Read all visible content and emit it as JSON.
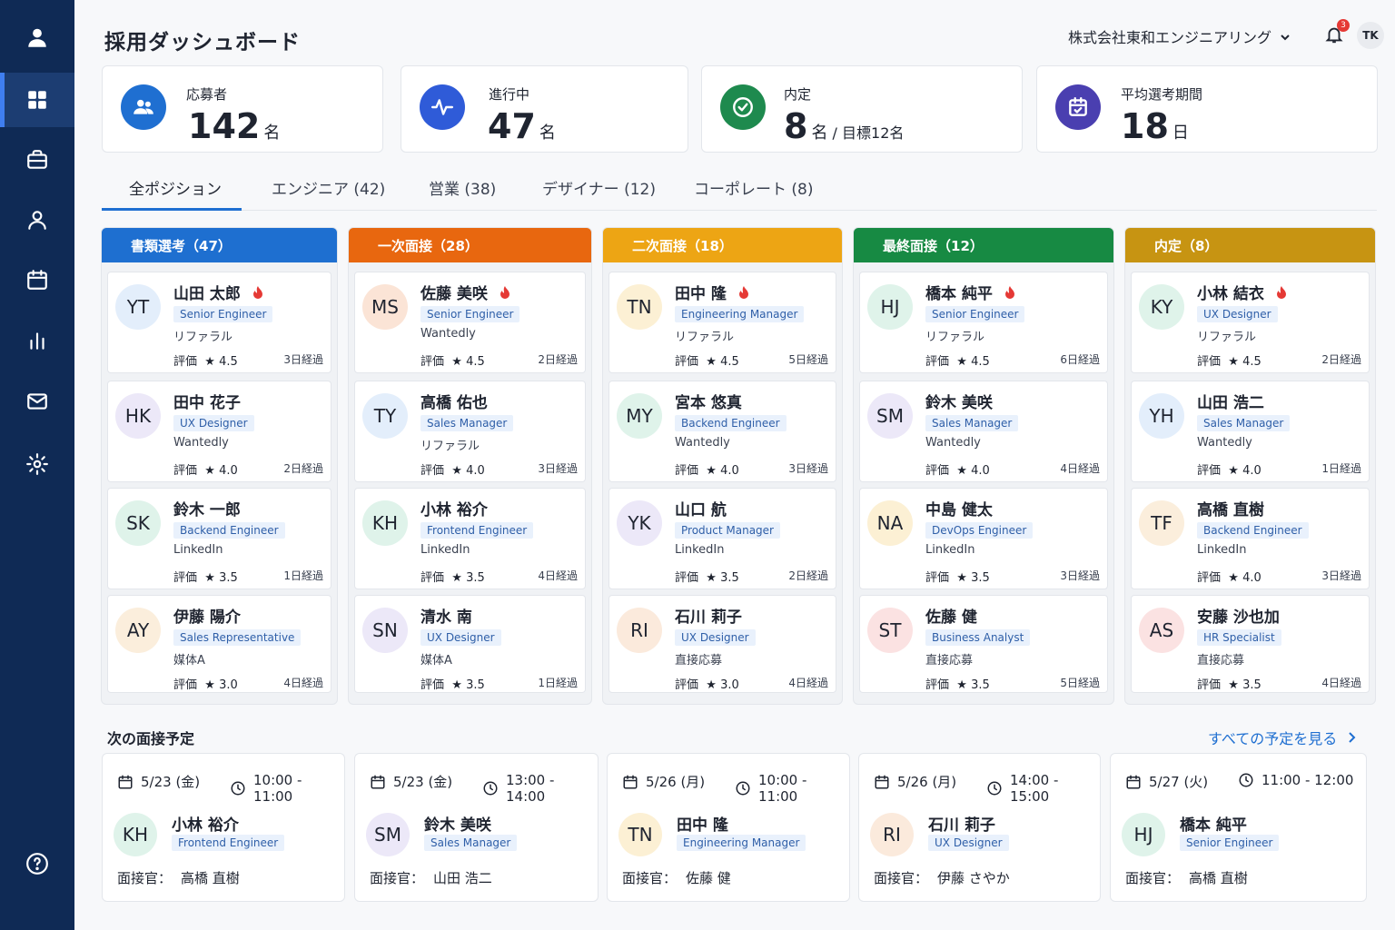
{
  "header": {
    "title": "採用ダッシュボード",
    "company": "株式会社東和エンジニアリング",
    "notifications": "3",
    "user_initials": "TK"
  },
  "sidebar": {
    "items": [
      {
        "icon": "user-circle-icon"
      },
      {
        "icon": "dashboard-grid-icon",
        "active": true
      },
      {
        "icon": "briefcase-icon"
      },
      {
        "icon": "person-icon"
      },
      {
        "icon": "calendar-icon"
      },
      {
        "icon": "bar-chart-icon"
      },
      {
        "icon": "mail-icon"
      },
      {
        "icon": "gear-icon"
      },
      {
        "icon": "help-icon"
      }
    ]
  },
  "kpis": [
    {
      "label": "応募者",
      "value": "142",
      "unit": "名",
      "color": "#1f6fd1",
      "icon": "users-icon"
    },
    {
      "label": "進行中",
      "value": "47",
      "unit": "名",
      "color": "#2f5bd8",
      "icon": "activity-icon"
    },
    {
      "label": "内定",
      "value": "8",
      "unit": "名",
      "sub": " / 目標12名",
      "color": "#1e8a4e",
      "icon": "check-circle-icon"
    },
    {
      "label": "平均選考期間",
      "value": "18",
      "unit": "日",
      "color": "#4a3fb0",
      "icon": "calendar-check-icon"
    }
  ],
  "tabs": [
    {
      "label": "全ポジション",
      "active": true
    },
    {
      "label": "エンジニア (42)"
    },
    {
      "label": "営業 (38)"
    },
    {
      "label": "デザイナー (12)"
    },
    {
      "label": "コーポレート (8)"
    }
  ],
  "stages": [
    {
      "title": "書類選考（47）",
      "color": "#1e6fd0",
      "cards": [
        {
          "initials": "YT",
          "name": "山田 太郎",
          "hot": true,
          "role": "Senior Engineer",
          "source": "リファラル",
          "rating_label": "評価",
          "rating": "★ 4.5",
          "days": "3日経過",
          "bg": "#e3eefb"
        },
        {
          "initials": "HK",
          "name": "田中 花子",
          "hot": false,
          "role": "UX Designer",
          "source": "Wantedly",
          "rating_label": "評価",
          "rating": "★ 4.0",
          "days": "2日経過",
          "bg": "#ece8f8"
        },
        {
          "initials": "SK",
          "name": "鈴木 一郎",
          "hot": false,
          "role": "Backend Engineer",
          "source": "LinkedIn",
          "rating_label": "評価",
          "rating": "★ 3.5",
          "days": "1日経過",
          "bg": "#dff3ea"
        },
        {
          "initials": "AY",
          "name": "伊藤 陽介",
          "hot": false,
          "role": "Sales Representative",
          "source": "媒体A",
          "rating_label": "評価",
          "rating": "★ 3.0",
          "days": "4日経過",
          "bg": "#fbeedc"
        }
      ]
    },
    {
      "title": "一次面接（28）",
      "color": "#e8670f",
      "cards": [
        {
          "initials": "MS",
          "name": "佐藤 美咲",
          "hot": true,
          "role": "Senior Engineer",
          "source": "Wantedly",
          "rating_label": "評価",
          "rating": "★ 4.5",
          "days": "2日経過",
          "bg": "#fbe4d6"
        },
        {
          "initials": "TY",
          "name": "高橋 佑也",
          "hot": false,
          "role": "Sales Manager",
          "source": "リファラル",
          "rating_label": "評価",
          "rating": "★ 4.0",
          "days": "3日経過",
          "bg": "#e3eefb"
        },
        {
          "initials": "KH",
          "name": "小林 裕介",
          "hot": false,
          "role": "Frontend Engineer",
          "source": "LinkedIn",
          "rating_label": "評価",
          "rating": "★ 3.5",
          "days": "4日経過",
          "bg": "#dff3ea"
        },
        {
          "initials": "SN",
          "name": "清水 南",
          "hot": false,
          "role": "UX Designer",
          "source": "媒体A",
          "rating_label": "評価",
          "rating": "★ 3.5",
          "days": "1日経過",
          "bg": "#ece8f8"
        }
      ]
    },
    {
      "title": "二次面接（18）",
      "color": "#eda514",
      "cards": [
        {
          "initials": "TN",
          "name": "田中 隆",
          "hot": true,
          "role": "Engineering Manager",
          "source": "リファラル",
          "rating_label": "評価",
          "rating": "★ 4.5",
          "days": "5日経過",
          "bg": "#fcf0d4"
        },
        {
          "initials": "MY",
          "name": "宮本 悠真",
          "hot": false,
          "role": "Backend Engineer",
          "source": "Wantedly",
          "rating_label": "評価",
          "rating": "★ 4.0",
          "days": "3日経過",
          "bg": "#dff3ea"
        },
        {
          "initials": "YK",
          "name": "山口 航",
          "hot": false,
          "role": "Product Manager",
          "source": "LinkedIn",
          "rating_label": "評価",
          "rating": "★ 3.5",
          "days": "2日経過",
          "bg": "#ece8f8"
        },
        {
          "initials": "RI",
          "name": "石川 莉子",
          "hot": false,
          "role": "UX Designer",
          "source": "直接応募",
          "rating_label": "評価",
          "rating": "★ 3.0",
          "days": "4日経過",
          "bg": "#fbeadc"
        }
      ]
    },
    {
      "title": "最終面接（12）",
      "color": "#178a43",
      "cards": [
        {
          "initials": "HJ",
          "name": "橋本 純平",
          "hot": true,
          "role": "Senior Engineer",
          "source": "リファラル",
          "rating_label": "評価",
          "rating": "★ 4.5",
          "days": "6日経過",
          "bg": "#dff3ea"
        },
        {
          "initials": "SM",
          "name": "鈴木 美咲",
          "hot": false,
          "role": "Sales Manager",
          "source": "Wantedly",
          "rating_label": "評価",
          "rating": "★ 4.0",
          "days": "4日経過",
          "bg": "#ece8f8"
        },
        {
          "initials": "NA",
          "name": "中島 健太",
          "hot": false,
          "role": "DevOps Engineer",
          "source": "LinkedIn",
          "rating_label": "評価",
          "rating": "★ 3.5",
          "days": "3日経過",
          "bg": "#fcf0d4"
        },
        {
          "initials": "ST",
          "name": "佐藤 健",
          "hot": false,
          "role": "Business Analyst",
          "source": "直接応募",
          "rating_label": "評価",
          "rating": "★ 3.5",
          "days": "5日経過",
          "bg": "#fbe2e2"
        }
      ]
    },
    {
      "title": "内定（8）",
      "color": "#c79412",
      "cards": [
        {
          "initials": "KY",
          "name": "小林 結衣",
          "hot": true,
          "role": "UX Designer",
          "source": "リファラル",
          "rating_label": "評価",
          "rating": "★ 4.5",
          "days": "2日経過",
          "bg": "#dff3ea"
        },
        {
          "initials": "YH",
          "name": "山田 浩二",
          "hot": false,
          "role": "Sales Manager",
          "source": "Wantedly",
          "rating_label": "評価",
          "rating": "★ 4.0",
          "days": "1日経過",
          "bg": "#e3eefb"
        },
        {
          "initials": "TF",
          "name": "高橋 直樹",
          "hot": false,
          "role": "Backend Engineer",
          "source": "LinkedIn",
          "rating_label": "評価",
          "rating": "★ 4.0",
          "days": "3日経過",
          "bg": "#fbeedc"
        },
        {
          "initials": "AS",
          "name": "安藤 沙也加",
          "hot": false,
          "role": "HR Specialist",
          "source": "直接応募",
          "rating_label": "評価",
          "rating": "★ 3.5",
          "days": "4日経過",
          "bg": "#fbe2e2"
        }
      ]
    }
  ],
  "interviews": {
    "title": "次の面接予定",
    "see_all": "すべての予定を見る",
    "items": [
      {
        "date": "5/23 (金)",
        "time": "10:00 - 11:00",
        "initials": "KH",
        "name": "小林 裕介",
        "role": "Frontend Engineer",
        "interviewer_label": "面接官：",
        "interviewer": "高橋 直樹",
        "bg": "#dff3ea"
      },
      {
        "date": "5/23 (金)",
        "time": "13:00 - 14:00",
        "initials": "SM",
        "name": "鈴木 美咲",
        "role": "Sales Manager",
        "interviewer_label": "面接官：",
        "interviewer": "山田 浩二",
        "bg": "#ece8f8"
      },
      {
        "date": "5/26 (月)",
        "time": "10:00 - 11:00",
        "initials": "TN",
        "name": "田中 隆",
        "role": "Engineering Manager",
        "interviewer_label": "面接官：",
        "interviewer": "佐藤 健",
        "bg": "#fcf0d4"
      },
      {
        "date": "5/26 (月)",
        "time": "14:00 - 15:00",
        "initials": "RI",
        "name": "石川 莉子",
        "role": "UX Designer",
        "interviewer_label": "面接官：",
        "interviewer": "伊藤 さやか",
        "bg": "#fbeadc"
      },
      {
        "date": "5/27 (火)",
        "time": "11:00 - 12:00",
        "initials": "HJ",
        "name": "橋本 純平",
        "role": "Senior Engineer",
        "interviewer_label": "面接官：",
        "interviewer": "高橋 直樹",
        "bg": "#dff3ea"
      }
    ]
  }
}
